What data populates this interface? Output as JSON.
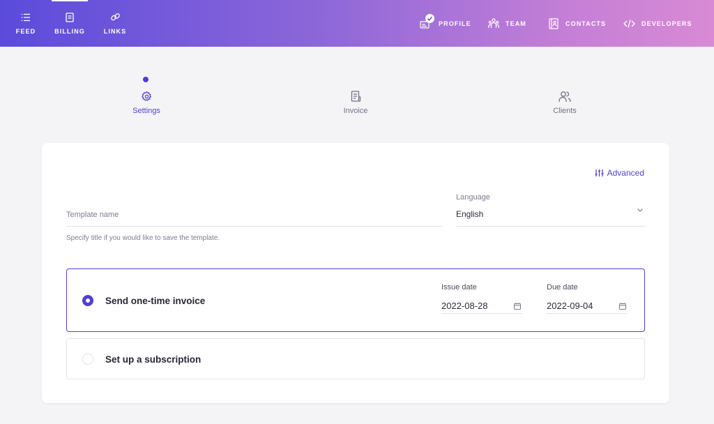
{
  "nav": {
    "left": [
      {
        "label": "FEED",
        "icon": "list-icon"
      },
      {
        "label": "BILLING",
        "icon": "document-icon",
        "active": true
      },
      {
        "label": "LINKS",
        "icon": "link-icon"
      }
    ],
    "right": [
      {
        "label": "PROFILE",
        "icon": "profile-card-icon"
      },
      {
        "label": "TEAM",
        "icon": "team-icon"
      },
      {
        "label": "CONTACTS",
        "icon": "contacts-book-icon"
      },
      {
        "label": "DEVELOPERS",
        "icon": "code-icon"
      }
    ],
    "gradient": [
      "#5b4bdb",
      "#d88ad4"
    ]
  },
  "stepper": {
    "steps": [
      {
        "label": "Settings",
        "icon": "gear-icon",
        "active": true
      },
      {
        "label": "Invoice",
        "icon": "invoice-icon"
      },
      {
        "label": "Clients",
        "icon": "users-icon"
      }
    ]
  },
  "form": {
    "advanced_label": "Advanced",
    "template_name_placeholder": "Template name",
    "template_helper": "Specify title if you would like to save the template.",
    "language_label": "Language",
    "language_value": "English",
    "options": [
      {
        "label": "Send one-time invoice",
        "selected": true
      },
      {
        "label": "Set up a subscription",
        "selected": false
      }
    ],
    "issue_date_label": "Issue date",
    "issue_date_value": "2022-08-28",
    "due_date_label": "Due date",
    "due_date_value": "2022-09-04"
  },
  "colors": {
    "accent": "#4f3fd6",
    "background": "#f4f4f6"
  }
}
